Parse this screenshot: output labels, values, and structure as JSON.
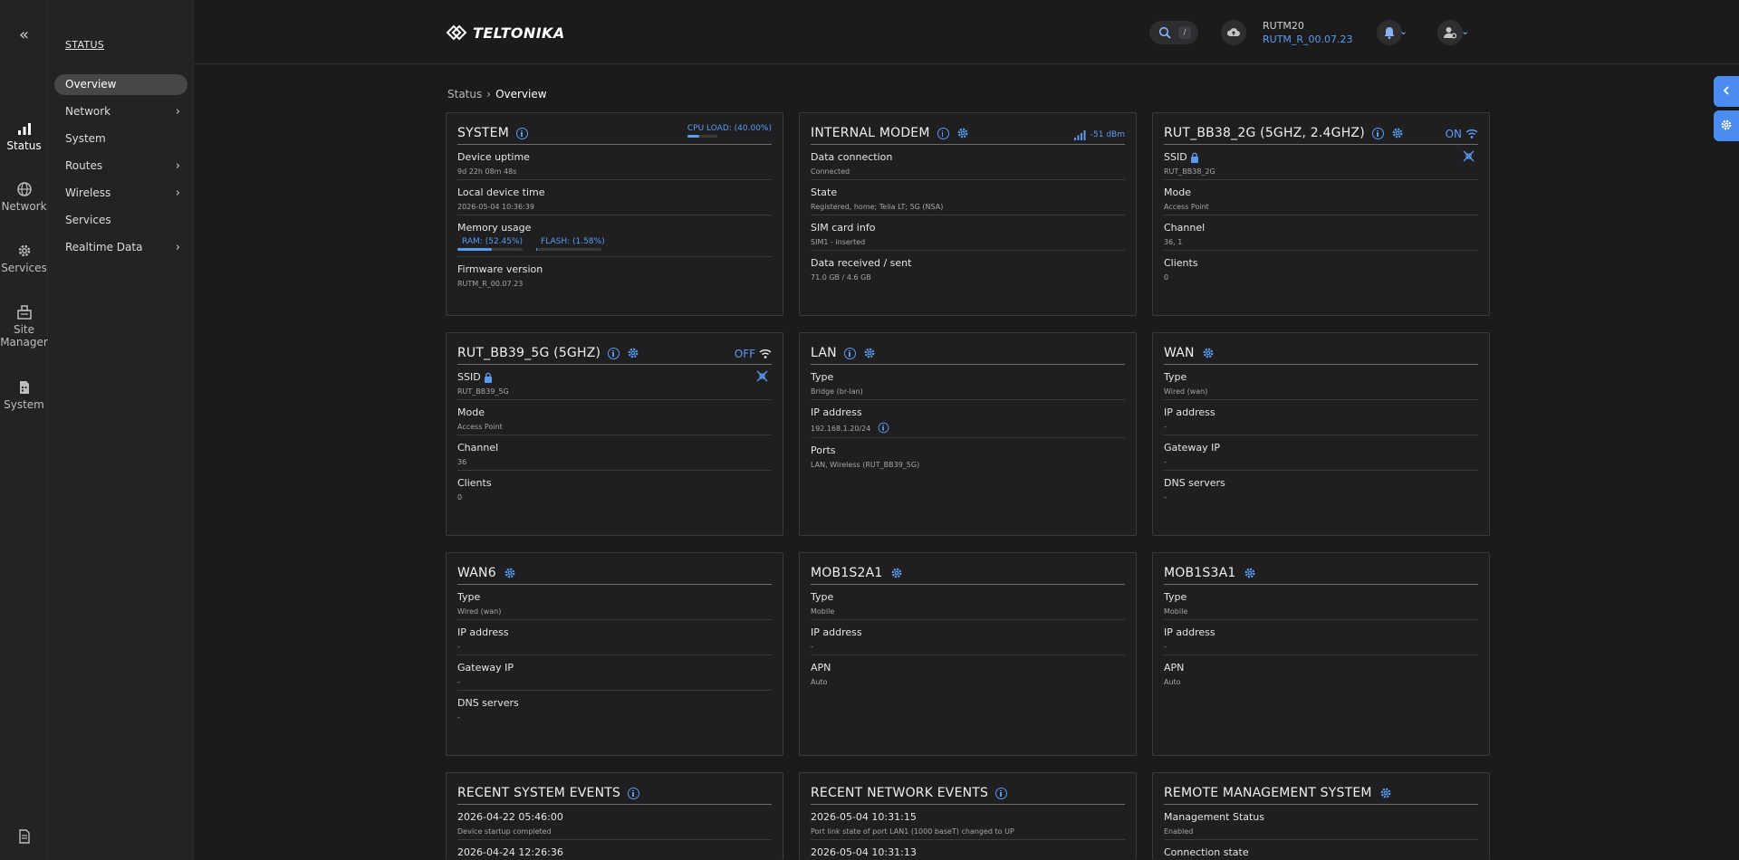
{
  "rail": {
    "items": [
      {
        "label": "Status",
        "icon": "status-bars-icon",
        "active": true
      },
      {
        "label": "Network",
        "icon": "globe-icon"
      },
      {
        "label": "Services",
        "icon": "gear-icon"
      },
      {
        "label": "Site Manager",
        "icon": "site-manager-icon"
      },
      {
        "label": "System",
        "icon": "system-file-icon"
      }
    ]
  },
  "menu": {
    "title": "STATUS",
    "items": [
      {
        "label": "Overview",
        "active": true,
        "chevron": false
      },
      {
        "label": "Network",
        "chevron": true
      },
      {
        "label": "System",
        "chevron": false
      },
      {
        "label": "Routes",
        "chevron": true
      },
      {
        "label": "Wireless",
        "chevron": true
      },
      {
        "label": "Services",
        "chevron": false
      },
      {
        "label": "Realtime Data",
        "chevron": true
      }
    ]
  },
  "header": {
    "brand": "TELTONIKA",
    "search_key": "/",
    "device_name": "RUTM20",
    "firmware": "RUTM_R_00.07.23"
  },
  "breadcrumb": {
    "root": "Status",
    "current": "Overview"
  },
  "cards": {
    "system": {
      "title": "SYSTEM",
      "cpu_label": "CPU LOAD: (40.00%)",
      "cpu_load": 0.4,
      "rows": [
        {
          "label": "Device uptime",
          "value": "9d 22h 08m 48s"
        },
        {
          "label": "Local device time",
          "value": "2026-05-04 10:36:39"
        },
        {
          "label": "Memory usage",
          "ram": "RAM: (52.45%)",
          "flash": "FLASH: (1.58%)",
          "ram_pct": 0.5245,
          "flash_pct": 0.0158
        },
        {
          "label": "Firmware version",
          "value": "RUTM_R_00.07.23"
        }
      ]
    },
    "modem": {
      "title": "INTERNAL MODEM",
      "signal": "-51 dBm",
      "rows": [
        {
          "label": "Data connection",
          "value": "Connected"
        },
        {
          "label": "State",
          "value": "Registered, home; Telia LT; 5G (NSA)"
        },
        {
          "label": "SIM card info",
          "value": "SIM1 - inserted"
        },
        {
          "label": "Data received / sent",
          "value": "71.0 GB / 4.6 GB"
        }
      ]
    },
    "wifi2g": {
      "title": "RUT_BB38_2G (5GHZ, 2.4GHZ)",
      "state": "ON",
      "rows": [
        {
          "label": "SSID",
          "value": "RUT_BB38_2G"
        },
        {
          "label": "Mode",
          "value": "Access Point"
        },
        {
          "label": "Channel",
          "value": "36, 1"
        },
        {
          "label": "Clients",
          "value": "0"
        }
      ]
    },
    "wifi5g": {
      "title": "RUT_BB39_5G (5GHZ)",
      "state": "OFF",
      "rows": [
        {
          "label": "SSID",
          "value": "RUT_BB39_5G"
        },
        {
          "label": "Mode",
          "value": "Access Point"
        },
        {
          "label": "Channel",
          "value": "36"
        },
        {
          "label": "Clients",
          "value": "0"
        }
      ]
    },
    "lan": {
      "title": "LAN",
      "rows": [
        {
          "label": "Type",
          "value": "Bridge (br-lan)"
        },
        {
          "label": "IP address",
          "value": "192.168.1.20/24"
        },
        {
          "label": "Ports",
          "value": "LAN, Wireless (RUT_BB39_5G)"
        }
      ]
    },
    "wan": {
      "title": "WAN",
      "rows": [
        {
          "label": "Type",
          "value": "Wired (wan)"
        },
        {
          "label": "IP address",
          "value": "-"
        },
        {
          "label": "Gateway IP",
          "value": "-"
        },
        {
          "label": "DNS servers",
          "value": "-"
        }
      ]
    },
    "wan6": {
      "title": "WAN6",
      "rows": [
        {
          "label": "Type",
          "value": "Wired (wan)"
        },
        {
          "label": "IP address",
          "value": "-"
        },
        {
          "label": "Gateway IP",
          "value": "-"
        },
        {
          "label": "DNS servers",
          "value": "-"
        }
      ]
    },
    "mob1s2a1": {
      "title": "MOB1S2A1",
      "rows": [
        {
          "label": "Type",
          "value": "Mobile"
        },
        {
          "label": "IP address",
          "value": "-"
        },
        {
          "label": "APN",
          "value": "Auto"
        }
      ]
    },
    "mob1s3a1": {
      "title": "MOB1S3A1",
      "rows": [
        {
          "label": "Type",
          "value": "Mobile"
        },
        {
          "label": "IP address",
          "value": "-"
        },
        {
          "label": "APN",
          "value": "Auto"
        }
      ]
    },
    "sys_events": {
      "title": "RECENT SYSTEM EVENTS",
      "rows": [
        {
          "label": "2026-04-22 05:46:00",
          "value": "Device startup completed"
        },
        {
          "label": "2026-04-24 12:26:36",
          "value": ""
        }
      ]
    },
    "net_events": {
      "title": "RECENT NETWORK EVENTS",
      "rows": [
        {
          "label": "2026-05-04 10:31:15",
          "value": "Port link state of port LAN1 (1000 baseT) changed to UP"
        },
        {
          "label": "2026-05-04 10:31:13",
          "value": ""
        }
      ]
    },
    "rms": {
      "title": "REMOTE MANAGEMENT SYSTEM",
      "rows": [
        {
          "label": "Management Status",
          "value": "Enabled"
        },
        {
          "label": "Connection state",
          "value": ""
        }
      ]
    }
  }
}
